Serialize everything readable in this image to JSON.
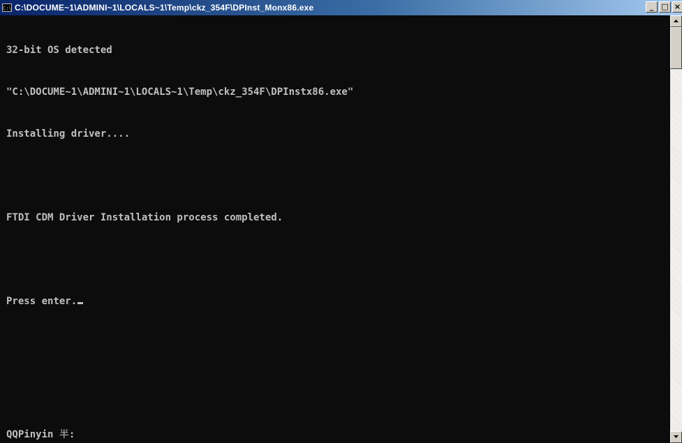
{
  "window": {
    "title": "C:\\DOCUME~1\\ADMINI~1\\LOCALS~1\\Temp\\ckz_354F\\DPInst_Monx86.exe",
    "icon_label": "C:\\",
    "buttons": {
      "minimize": "_",
      "maximize": "□",
      "close": "×"
    }
  },
  "console": {
    "lines": [
      "32-bit OS detected",
      "\"C:\\DOCUME~1\\ADMINI~1\\LOCALS~1\\Temp\\ckz_354F\\DPInstx86.exe\"",
      "Installing driver....",
      "",
      "FTDI CDM Driver Installation process completed.",
      "",
      "Press enter."
    ],
    "text_color": "#c0c0c0",
    "background_color": "#0c0c0c"
  },
  "ime": {
    "name": "QQPinyin",
    "mode": "半",
    "suffix": ":"
  },
  "icons": {
    "title_icon": "console-window-icon",
    "scroll_up": "arrow-up-icon",
    "scroll_down": "arrow-down-icon"
  }
}
